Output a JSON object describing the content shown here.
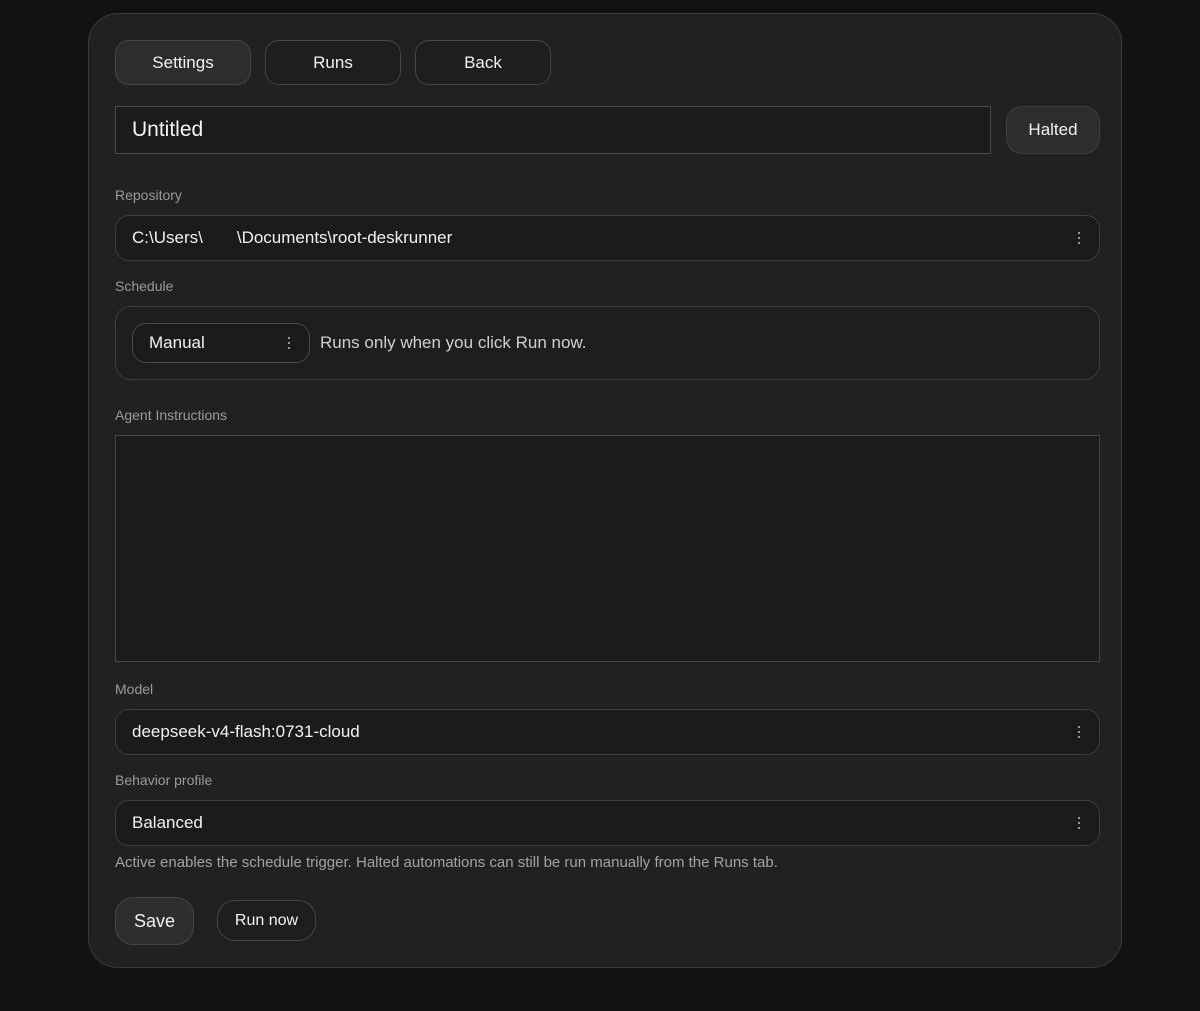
{
  "tabs": [
    {
      "label": "Settings",
      "active": true
    },
    {
      "label": "Runs",
      "active": false
    },
    {
      "label": "Back",
      "active": false
    }
  ],
  "automation": {
    "title": "Untitled",
    "status": "Halted"
  },
  "repository": {
    "label": "Repository",
    "path_prefix": "C:\\Users\\",
    "path_suffix": "\\Documents\\root-deskrunner"
  },
  "schedule": {
    "label": "Schedule",
    "value": "Manual",
    "description": "Runs only when you click Run now."
  },
  "instructions": {
    "label": "Agent Instructions",
    "value": ""
  },
  "model": {
    "label": "Model",
    "value": "deepseek-v4-flash:0731-cloud"
  },
  "behavior": {
    "label": "Behavior profile",
    "value": "Balanced"
  },
  "hint": "Active enables the schedule trigger. Halted automations can still be run manually from the Runs tab.",
  "actions": {
    "save_label": "Save",
    "run_label": "Run now"
  },
  "icons": {
    "select_menu": "kebab-icon"
  },
  "colors": {
    "background": "#121212",
    "panel": "#212121",
    "border": "#3e3e3e"
  }
}
